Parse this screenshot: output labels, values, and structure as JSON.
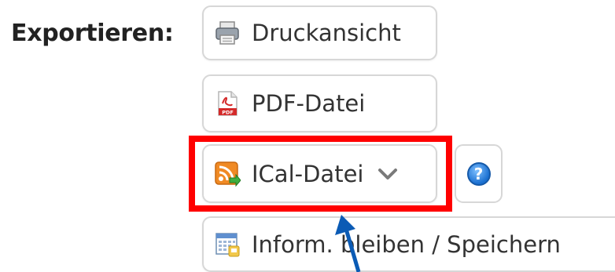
{
  "export": {
    "label": "Exportieren:",
    "buttons": {
      "print": {
        "label": "Druckansicht",
        "icon": "printer-icon"
      },
      "pdf": {
        "label": "PDF-Datei",
        "icon": "pdf-file-icon"
      },
      "ical": {
        "label": "ICal-Datei",
        "icon": "rss-feed-icon",
        "dropdown_icon": "chevron-down-icon"
      },
      "info": {
        "label": "Inform. bleiben / Speichern",
        "icon": "calendar-icon"
      },
      "help": {
        "label": "?",
        "icon": "help-icon"
      }
    }
  },
  "annotation": {
    "highlight_color": "#ff0000",
    "arrow_color": "#0b5bb5"
  }
}
